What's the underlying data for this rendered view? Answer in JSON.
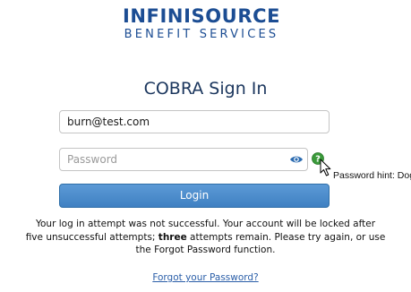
{
  "logo": {
    "main": "INFINISOURCE",
    "sub": "BENEFIT SERVICES"
  },
  "title": "COBRA Sign In",
  "email_field": {
    "value": "burn@test.com"
  },
  "password_field": {
    "value": "",
    "placeholder": "Password"
  },
  "password_hint": "Password hint: Dog",
  "login_button": {
    "label": "Login"
  },
  "message": {
    "line1": "Your log in attempt was not successful. Your account will be locked after",
    "line2_pre": "five unsuccessful attempts; ",
    "line2_bold": "three",
    "line2_post": " attempts remain. Please try again, or use",
    "line3": "the Forgot Password function."
  },
  "forgot_link": "Forgot your Password?",
  "icons": {
    "eye": "eye-icon",
    "help": "help-question-icon",
    "cursor": "mouse-cursor-icon"
  },
  "colors": {
    "brand": "#1c4d93",
    "button": "#4a8acb",
    "link": "#2a5ea8",
    "help_icon": "#3a9a3a"
  }
}
